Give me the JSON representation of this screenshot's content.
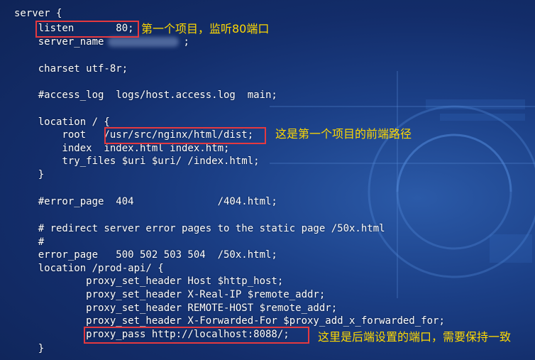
{
  "code_lines": [
    "server {",
    "    listen       80;",
    "    server_name",
    ";",
    "    charset utf-8r;",
    "    #access_log  logs/host.access.log  main;",
    "    location / {",
    "        root   /usr/src/nginx/html/dist;",
    "        index  index.html index.htm;",
    "        try_files $uri $uri/ /index.html;",
    "    }",
    "    #error_page  404              /404.html;",
    "    # redirect server error pages to the static page /50x.html",
    "    #",
    "    error_page   500 502 503 504  /50x.html;",
    "    location /prod-api/ {",
    "            proxy_set_header Host $http_host;",
    "            proxy_set_header X-Real-IP $remote_addr;",
    "            proxy_set_header REMOTE-HOST $remote_addr;",
    "            proxy_set_header X-Forwarded-For $proxy_add_x_forwarded_for;",
    "            proxy_pass http://localhost:8088/;",
    "    }"
  ],
  "annotations": {
    "port_note": "第一个项目，监听80端口",
    "root_note": "这是第一个项目的前端路径",
    "proxy_note": "这里是后端设置的端口，需要保持一致"
  },
  "colors": {
    "highlight_box": "#e5393f",
    "annotation_text": "#ffd900",
    "code_text": "#ffffff"
  }
}
